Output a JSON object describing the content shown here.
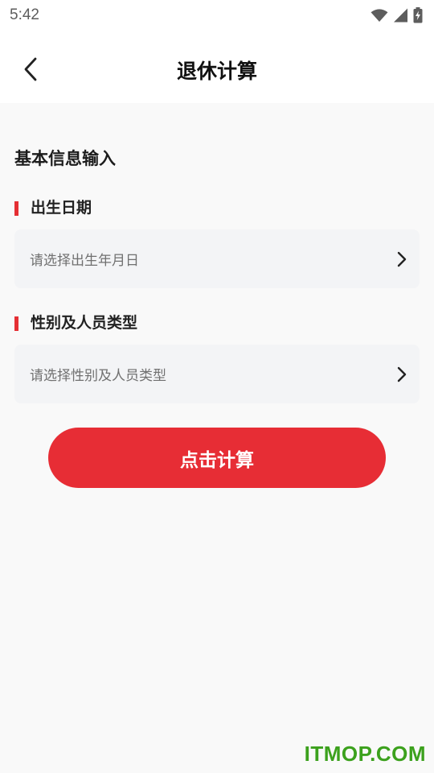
{
  "status_bar": {
    "time": "5:42",
    "icons": [
      "wifi-icon",
      "signal-icon",
      "battery-charging-icon"
    ]
  },
  "header": {
    "back_icon": "chevron-left-icon",
    "title": "退休计算"
  },
  "form": {
    "section_title": "基本信息输入",
    "fields": [
      {
        "label": "出生日期",
        "placeholder": "请选择出生年月日",
        "icon": "chevron-right-icon"
      },
      {
        "label": "性别及人员类型",
        "placeholder": "请选择性别及人员类型",
        "icon": "chevron-right-icon"
      }
    ],
    "submit_label": "点击计算"
  },
  "watermark": "ITMOP.COM",
  "colors": {
    "accent": "#e72d35",
    "background": "#f9f9f9",
    "field_background": "#f3f4f6",
    "watermark": "#3ca11d"
  }
}
